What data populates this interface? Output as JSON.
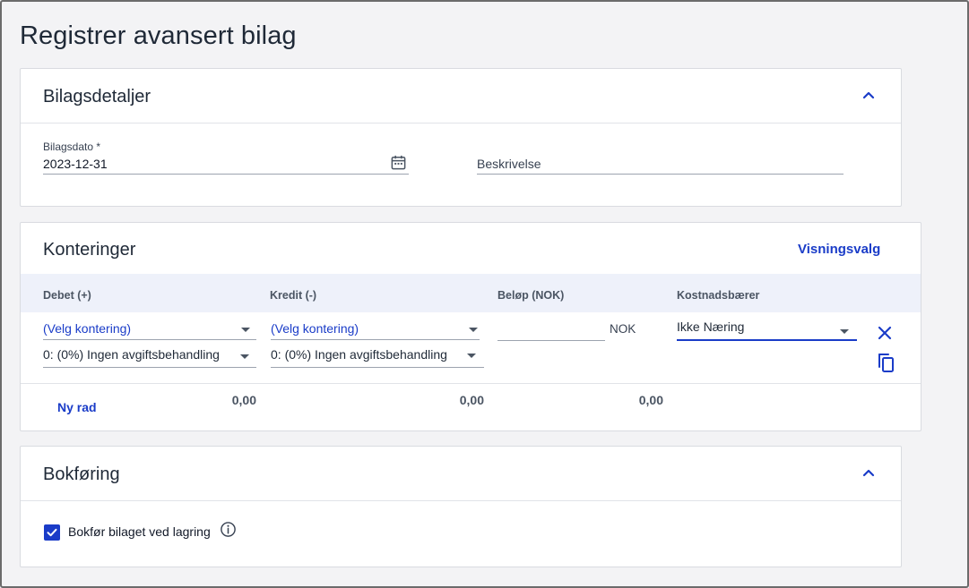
{
  "page": {
    "title": "Registrer avansert bilag"
  },
  "details": {
    "title": "Bilagsdetaljer",
    "date_label": "Bilagsdato *",
    "date_value": "2023-12-31",
    "description_placeholder": "Beskrivelse"
  },
  "postings": {
    "title": "Konteringer",
    "view_options": "Visningsvalg",
    "columns": {
      "debit": "Debet (+)",
      "credit": "Kredit (-)",
      "amount": "Beløp (NOK)",
      "cost_carrier": "Kostnadsbærer"
    },
    "row": {
      "debit_account": "(Velg kontering)",
      "debit_vat": "0: (0%) Ingen avgiftsbehandling",
      "credit_account": "(Velg kontering)",
      "credit_vat": "0: (0%) Ingen avgiftsbehandling",
      "amount_value": "",
      "currency": "NOK",
      "cost_carrier_value": "Ikke Næring"
    },
    "new_row": "Ny rad",
    "totals": {
      "debit": "0,00",
      "credit": "0,00",
      "amount": "0,00"
    }
  },
  "booking": {
    "title": "Bokføring",
    "checkbox_label": "Bokfør bilaget ved lagring",
    "checked": true
  },
  "colors": {
    "accent": "#1a3cc8",
    "table_header_bg": "#eef1fa"
  }
}
